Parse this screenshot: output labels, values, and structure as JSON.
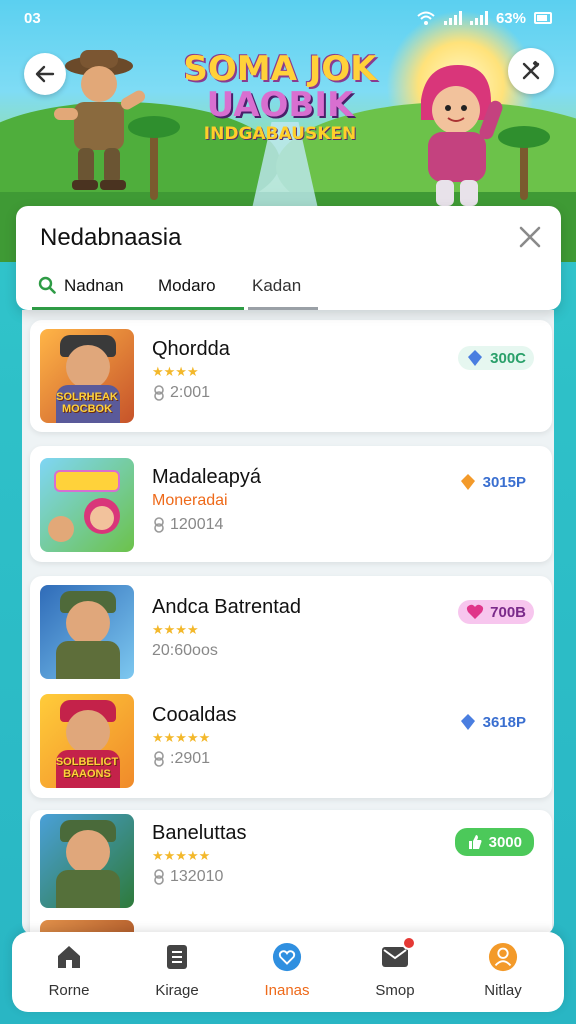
{
  "status": {
    "time": "03",
    "battery": "63%"
  },
  "banner": {
    "title_line1": "SOMA JOK",
    "title_line2": "UAOBIK",
    "title_line3": "INDGABAUSKEN"
  },
  "panel": {
    "title": "Nedabnaasia",
    "tabs": [
      {
        "label": "Nadnan",
        "active": true
      },
      {
        "label": "Modaro"
      },
      {
        "label": "Kadan"
      }
    ]
  },
  "list": [
    {
      "name": "Qhordda",
      "stars": "★★★★",
      "meta": "2:001",
      "badge": "300C",
      "badge_icon": "gem-blue",
      "thumb_label": "SOLRHEAK MOCBOK"
    },
    {
      "name": "Madaleapyá",
      "subtitle": "Moneradai",
      "meta": "120014",
      "badge": "3015P",
      "badge_icon": "gem-orange"
    },
    {
      "name": "Andca Batrentad",
      "stars": "★★★★",
      "meta_plain": "20:60oos",
      "badge": "700B",
      "badge_icon": "heart"
    },
    {
      "name": "Cooaldas",
      "stars": "★★★★★",
      "meta": ":2901",
      "badge": "3618P",
      "badge_icon": "gem-blue",
      "thumb_label": "SOLBELICT BAAONS"
    },
    {
      "name": "Baneluttas",
      "stars": "★★★★★",
      "meta": "132010",
      "badge": "3000",
      "badge_icon": "thumbs-up"
    }
  ],
  "nav": [
    {
      "label": "Rorne",
      "icon": "home-icon"
    },
    {
      "label": "Kirage",
      "icon": "storage-icon"
    },
    {
      "label": "Inanas",
      "icon": "heart-circle-icon",
      "active": true
    },
    {
      "label": "Smop",
      "icon": "mail-icon"
    },
    {
      "label": "Nitlay",
      "icon": "profile-icon"
    }
  ],
  "colors": {
    "accent": "#ee6a1a",
    "teal": "#2ec0c8",
    "green_badge": "#4cc95a",
    "pink_badge": "#f7c6ee"
  }
}
